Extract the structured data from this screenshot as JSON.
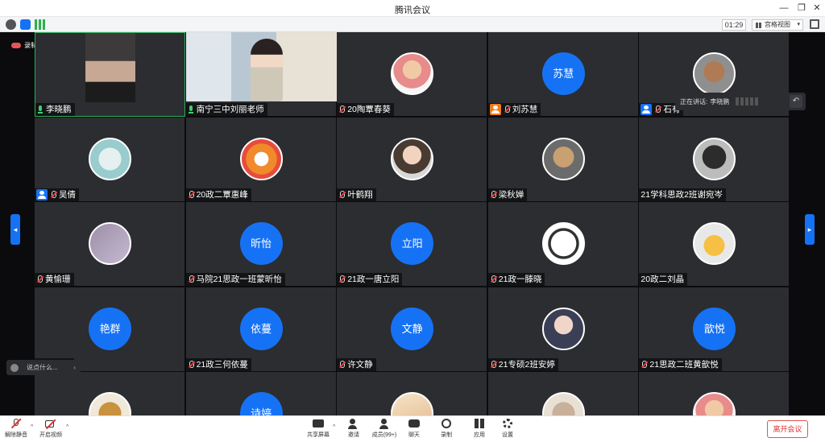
{
  "window": {
    "title": "腾讯会议"
  },
  "infobar": {
    "timer": "01:29",
    "view_mode": "宫格视图"
  },
  "recording": {
    "label": "录制中"
  },
  "speaking": {
    "prefix": "正在讲话:",
    "speaker": "李晓鹏"
  },
  "chat": {
    "placeholder": "说点什么..."
  },
  "participants": [
    {
      "name": "李晓鹏",
      "mic": "on",
      "type": "video"
    },
    {
      "name": "南宁三中刘丽老师",
      "mic": "on",
      "type": "video"
    },
    {
      "name": "20陶覃春葵",
      "mic": "muted",
      "type": "img"
    },
    {
      "name": "刘苏慧",
      "mic": "muted",
      "type": "text",
      "avatar_text": "苏慧",
      "role": "host"
    },
    {
      "name": "石有",
      "mic": "muted",
      "type": "img",
      "role": "cohost"
    },
    {
      "name": "吴倩",
      "mic": "muted",
      "type": "img",
      "role": "cohost"
    },
    {
      "name": "20政二覃惠峰",
      "mic": "muted",
      "type": "img"
    },
    {
      "name": "叶鹤翔",
      "mic": "muted",
      "type": "img"
    },
    {
      "name": "梁秋婵",
      "mic": "muted",
      "type": "img"
    },
    {
      "name": "21学科思政2班谢宛岑",
      "mic": "none",
      "type": "img"
    },
    {
      "name": "黄愉珊",
      "mic": "muted",
      "type": "img"
    },
    {
      "name": "马院21思政一班蒙昕怡",
      "mic": "muted",
      "type": "text",
      "avatar_text": "昕怡"
    },
    {
      "name": "21政一唐立阳",
      "mic": "muted",
      "type": "text",
      "avatar_text": "立阳"
    },
    {
      "name": "21政一滕晓",
      "mic": "muted",
      "type": "img"
    },
    {
      "name": "20政二刘晶",
      "mic": "none",
      "type": "img"
    },
    {
      "name": "黄艳群",
      "mic": "muted",
      "type": "text",
      "avatar_text": "艳群"
    },
    {
      "name": "21政三何依蔓",
      "mic": "muted",
      "type": "text",
      "avatar_text": "依蔓"
    },
    {
      "name": "许文静",
      "mic": "muted",
      "type": "text",
      "avatar_text": "文静"
    },
    {
      "name": "21专硕2班安婷",
      "mic": "muted",
      "type": "img"
    },
    {
      "name": "21思政二班黄歆悦",
      "mic": "muted",
      "type": "text",
      "avatar_text": "歆悦"
    },
    {
      "name": "",
      "mic": "none",
      "type": "img"
    },
    {
      "name": "",
      "mic": "none",
      "type": "text",
      "avatar_text": "诗婷"
    },
    {
      "name": "",
      "mic": "none",
      "type": "img"
    },
    {
      "name": "",
      "mic": "none",
      "type": "img"
    },
    {
      "name": "",
      "mic": "none",
      "type": "img"
    }
  ],
  "toolbar": {
    "unmute": "解除静音",
    "start_video": "开启视频",
    "share_screen": "共享屏幕",
    "invite": "邀请",
    "members": "成员(99+)",
    "chat": "聊天",
    "record": "录制",
    "apps": "应用",
    "settings": "设置",
    "leave": "离开会议"
  },
  "colors": {
    "accent": "#1672f5",
    "tile": "#2b2d31",
    "leave": "#e03030"
  }
}
